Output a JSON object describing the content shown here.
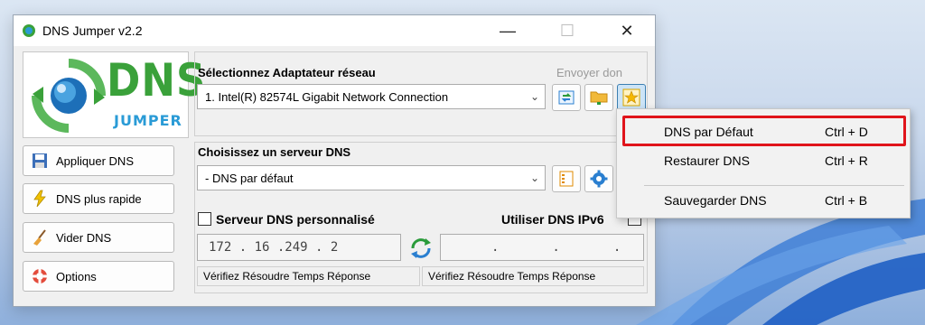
{
  "window": {
    "title": "DNS Jumper v2.2"
  },
  "logo": {
    "dns": "DNS",
    "jumper": "JUMPER"
  },
  "sidebar": {
    "buttons": [
      {
        "label": "Appliquer DNS",
        "icon": "floppy-disk-icon"
      },
      {
        "label": "DNS plus rapide",
        "icon": "lightning-icon"
      },
      {
        "label": "Vider DNS",
        "icon": "broom-icon"
      },
      {
        "label": "Options",
        "icon": "lifebuoy-icon"
      }
    ]
  },
  "adapter": {
    "label": "Sélectionnez Adaptateur réseau",
    "donate_link": "Envoyer don",
    "selected": "1. Intel(R) 82574L Gigabit Network Connection"
  },
  "dns_server": {
    "label": "Choisissez un serveur DNS",
    "selected": "-  DNS par défaut"
  },
  "custom": {
    "label": "Serveur DNS personnalisé",
    "ipv6_label": "Utiliser DNS IPv6",
    "primary_ip": "172 . 16 .249 . 2",
    "secondary_ip": ".       .       ."
  },
  "status": {
    "left": "Vérifiez Résoudre Temps Réponse",
    "right": "Vérifiez Résoudre Temps Réponse"
  },
  "context_menu": {
    "items": [
      {
        "label": "DNS par Défaut",
        "shortcut": "Ctrl + D"
      },
      {
        "label": "Restaurer DNS",
        "shortcut": "Ctrl + R"
      },
      {
        "label": "Sauvegarder DNS",
        "shortcut": "Ctrl + B"
      }
    ]
  },
  "colors": {
    "logo_green": "#3aa13a",
    "logo_blue": "#2a9bd6",
    "highlight_red": "#e0141b"
  }
}
